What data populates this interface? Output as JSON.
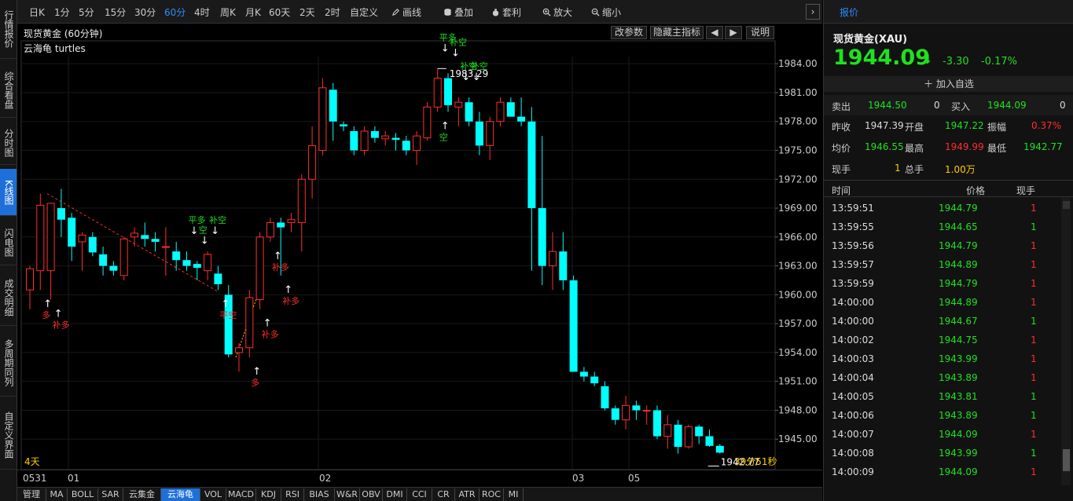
{
  "sidebar": {
    "tabs": [
      {
        "label": "行情报价",
        "active": false
      },
      {
        "label": "综合看盘",
        "active": false
      },
      {
        "label": "分时图",
        "active": false
      },
      {
        "label": "K线图",
        "active": true
      },
      {
        "label": "闪电图",
        "active": false
      },
      {
        "label": "成交明细",
        "active": false
      },
      {
        "label": "多周期同列",
        "active": false
      },
      {
        "label": "自定义界面",
        "active": false
      }
    ]
  },
  "toolbar": {
    "periods": [
      "日K",
      "1分",
      "5分",
      "15分",
      "30分",
      "60分",
      "4时",
      "周K",
      "月K",
      "60天",
      "2天",
      "2时",
      "自定义"
    ],
    "active_period": "60分",
    "tools": {
      "draw": "画线",
      "overlay": "叠加",
      "arbitrage": "套利",
      "zoom_in": "放大",
      "zoom_out": "缩小"
    },
    "next_icon": "chevron-right-icon"
  },
  "chart_header": {
    "title": "现货黄金 (60分钟)",
    "params_button": "改参数",
    "hide_indicator_button": "隐藏主指标",
    "explain_button": "说明",
    "indicator_label": "云海龟 turtles"
  },
  "chart_data": {
    "type": "candlestick",
    "title": "现货黄金 (60分钟)",
    "y_ticks": [
      "1984.00",
      "1981.00",
      "1978.00",
      "1975.00",
      "1972.00",
      "1969.00",
      "1966.00",
      "1963.00",
      "1960.00",
      "1957.00",
      "1954.00",
      "1951.00",
      "1948.00",
      "1945.00"
    ],
    "ylim": [
      1942.0,
      1985.4
    ],
    "x_labels": [
      "0531",
      "01",
      "02",
      "03",
      "05"
    ],
    "period_label": "4天",
    "countdown": "39分51秒",
    "high_label": "1983.29",
    "low_label": "1942.77",
    "candles": [
      {
        "o": 1960.5,
        "h": 1963.0,
        "l": 1958.5,
        "c": 1962.7
      },
      {
        "o": 1962.5,
        "h": 1970.5,
        "l": 1960.5,
        "c": 1969.3
      },
      {
        "o": 1962.5,
        "h": 1969.5,
        "l": 1959.5,
        "c": 1969.5
      },
      {
        "o": 1969.0,
        "h": 1971.0,
        "l": 1966.0,
        "c": 1967.8
      },
      {
        "o": 1968.0,
        "h": 1968.5,
        "l": 1963.5,
        "c": 1965.0
      },
      {
        "o": 1965.5,
        "h": 1966.5,
        "l": 1962.5,
        "c": 1966.2
      },
      {
        "o": 1966.0,
        "h": 1966.5,
        "l": 1964.0,
        "c": 1964.4
      },
      {
        "o": 1964.2,
        "h": 1965.0,
        "l": 1962.0,
        "c": 1963.0
      },
      {
        "o": 1963.0,
        "h": 1963.5,
        "l": 1962.0,
        "c": 1962.5
      },
      {
        "o": 1962.0,
        "h": 1966.0,
        "l": 1961.5,
        "c": 1965.8
      },
      {
        "o": 1966.0,
        "h": 1967.0,
        "l": 1965.0,
        "c": 1966.4
      },
      {
        "o": 1966.2,
        "h": 1967.5,
        "l": 1965.0,
        "c": 1965.8
      },
      {
        "o": 1965.8,
        "h": 1966.5,
        "l": 1964.5,
        "c": 1965.5
      },
      {
        "o": 1965.0,
        "h": 1967.0,
        "l": 1962.0,
        "c": 1965.0
      },
      {
        "o": 1964.5,
        "h": 1965.5,
        "l": 1962.5,
        "c": 1963.6
      },
      {
        "o": 1963.6,
        "h": 1964.5,
        "l": 1962.5,
        "c": 1963.0
      },
      {
        "o": 1963.2,
        "h": 1963.5,
        "l": 1961.5,
        "c": 1962.8
      },
      {
        "o": 1962.5,
        "h": 1964.5,
        "l": 1961.5,
        "c": 1964.2
      },
      {
        "o": 1962.2,
        "h": 1963.0,
        "l": 1960.5,
        "c": 1961.1
      },
      {
        "o": 1960.0,
        "h": 1961.0,
        "l": 1953.5,
        "c": 1953.8
      },
      {
        "o": 1954.0,
        "h": 1955.0,
        "l": 1952.0,
        "c": 1954.5
      },
      {
        "o": 1954.5,
        "h": 1960.5,
        "l": 1953.5,
        "c": 1959.7
      },
      {
        "o": 1959.5,
        "h": 1966.5,
        "l": 1958.5,
        "c": 1966.0
      },
      {
        "o": 1966.0,
        "h": 1968.0,
        "l": 1965.5,
        "c": 1967.5
      },
      {
        "o": 1967.5,
        "h": 1968.0,
        "l": 1962.0,
        "c": 1967.0
      },
      {
        "o": 1967.5,
        "h": 1968.5,
        "l": 1966.5,
        "c": 1967.8
      },
      {
        "o": 1967.5,
        "h": 1972.5,
        "l": 1964.5,
        "c": 1972.0
      },
      {
        "o": 1972.0,
        "h": 1977.5,
        "l": 1970.0,
        "c": 1975.5
      },
      {
        "o": 1975.0,
        "h": 1982.5,
        "l": 1974.5,
        "c": 1981.5
      },
      {
        "o": 1981.3,
        "h": 1982.0,
        "l": 1976.0,
        "c": 1978.0
      },
      {
        "o": 1977.7,
        "h": 1978.0,
        "l": 1977.0,
        "c": 1977.5
      },
      {
        "o": 1977.0,
        "h": 1977.5,
        "l": 1974.5,
        "c": 1975.0
      },
      {
        "o": 1975.0,
        "h": 1977.5,
        "l": 1974.5,
        "c": 1977.0
      },
      {
        "o": 1977.0,
        "h": 1977.5,
        "l": 1975.8,
        "c": 1976.3
      },
      {
        "o": 1976.2,
        "h": 1977.0,
        "l": 1975.5,
        "c": 1976.5
      },
      {
        "o": 1976.3,
        "h": 1976.8,
        "l": 1975.0,
        "c": 1976.1
      },
      {
        "o": 1976.0,
        "h": 1976.5,
        "l": 1974.5,
        "c": 1975.0
      },
      {
        "o": 1975.0,
        "h": 1977.0,
        "l": 1973.5,
        "c": 1976.5
      },
      {
        "o": 1976.3,
        "h": 1980.0,
        "l": 1976.0,
        "c": 1979.5
      },
      {
        "o": 1979.5,
        "h": 1983.5,
        "l": 1979.0,
        "c": 1982.5
      },
      {
        "o": 1982.5,
        "h": 1983.0,
        "l": 1979.0,
        "c": 1979.7
      },
      {
        "o": 1979.5,
        "h": 1980.5,
        "l": 1977.5,
        "c": 1980.0
      },
      {
        "o": 1980.0,
        "h": 1980.5,
        "l": 1977.5,
        "c": 1978.0
      },
      {
        "o": 1978.0,
        "h": 1979.0,
        "l": 1974.5,
        "c": 1975.5
      },
      {
        "o": 1975.5,
        "h": 1978.5,
        "l": 1974.0,
        "c": 1978.0
      },
      {
        "o": 1978.0,
        "h": 1980.5,
        "l": 1977.5,
        "c": 1980.0
      },
      {
        "o": 1980.0,
        "h": 1980.5,
        "l": 1978.5,
        "c": 1978.5
      },
      {
        "o": 1978.5,
        "h": 1980.5,
        "l": 1977.5,
        "c": 1978.0
      },
      {
        "o": 1978.0,
        "h": 1979.5,
        "l": 1962.5,
        "c": 1969.0
      },
      {
        "o": 1969.0,
        "h": 1976.5,
        "l": 1961.0,
        "c": 1963.0
      },
      {
        "o": 1963.0,
        "h": 1966.5,
        "l": 1960.5,
        "c": 1964.5
      },
      {
        "o": 1964.5,
        "h": 1966.5,
        "l": 1960.5,
        "c": 1961.5
      },
      {
        "o": 1961.5,
        "h": 1962.0,
        "l": 1952.0,
        "c": 1952.0
      },
      {
        "o": 1952.0,
        "h": 1952.5,
        "l": 1951.0,
        "c": 1951.5
      },
      {
        "o": 1951.5,
        "h": 1952.0,
        "l": 1950.5,
        "c": 1950.8
      },
      {
        "o": 1950.5,
        "h": 1951.0,
        "l": 1948.0,
        "c": 1948.2
      },
      {
        "o": 1948.2,
        "h": 1948.5,
        "l": 1946.5,
        "c": 1947.0
      },
      {
        "o": 1947.0,
        "h": 1949.5,
        "l": 1946.0,
        "c": 1948.5
      },
      {
        "o": 1948.5,
        "h": 1949.0,
        "l": 1947.0,
        "c": 1948.0
      },
      {
        "o": 1948.0,
        "h": 1948.5,
        "l": 1946.5,
        "c": 1948.0
      },
      {
        "o": 1948.0,
        "h": 1948.5,
        "l": 1945.0,
        "c": 1945.3
      },
      {
        "o": 1945.3,
        "h": 1947.5,
        "l": 1944.0,
        "c": 1946.5
      },
      {
        "o": 1946.5,
        "h": 1947.0,
        "l": 1943.5,
        "c": 1944.2
      },
      {
        "o": 1944.2,
        "h": 1946.5,
        "l": 1944.0,
        "c": 1946.3
      },
      {
        "o": 1946.3,
        "h": 1946.5,
        "l": 1944.5,
        "c": 1945.3
      },
      {
        "o": 1945.3,
        "h": 1946.0,
        "l": 1944.2,
        "c": 1944.3
      },
      {
        "o": 1944.3,
        "h": 1944.5,
        "l": 1943.5,
        "c": 1943.6
      }
    ],
    "signals": [
      {
        "label": "多",
        "color": "#ff2d2d",
        "arrow": "up",
        "index": 1
      },
      {
        "label": "补多",
        "color": "#ff2d2d",
        "arrow": "up",
        "index": 2
      },
      {
        "label": "平多",
        "color": "#1fe11f",
        "arrow": "down",
        "index": 15
      },
      {
        "label": "空",
        "color": "#1fe11f",
        "arrow": "down",
        "index": 16
      },
      {
        "label": "补空",
        "color": "#1fe11f",
        "arrow": "down",
        "index": 17
      },
      {
        "label": "平空",
        "color": "#ff2d2d",
        "arrow": "up",
        "index": 18
      },
      {
        "label": "多",
        "color": "#ff2d2d",
        "arrow": "up",
        "index": 21
      },
      {
        "label": "补多",
        "color": "#ff2d2d",
        "arrow": "up",
        "index": 22
      },
      {
        "label": "补多",
        "color": "#ff2d2d",
        "arrow": "up",
        "index": 23
      },
      {
        "label": "补多",
        "color": "#ff2d2d",
        "arrow": "up",
        "index": 24
      },
      {
        "label": "平多",
        "color": "#1fe11f",
        "arrow": "down",
        "index": 39
      },
      {
        "label": "补空",
        "color": "#1fe11f",
        "arrow": "down",
        "index": 40
      },
      {
        "label": "空",
        "color": "#1fe11f",
        "arrow": "up",
        "index": 39
      },
      {
        "label": "补空",
        "color": "#1fe11f",
        "arrow": "down",
        "index": 41
      },
      {
        "label": "补空",
        "color": "#1fe11f",
        "arrow": "down",
        "index": 42
      }
    ],
    "colors": {
      "up": "#ff2d2d",
      "down": "#00ffff",
      "trend": "#ff2d2d"
    }
  },
  "bottom_tabs": {
    "items": [
      "管理",
      "MA",
      "BOLL",
      "SAR",
      "云集金",
      "云海龟",
      "VOL",
      "MACD",
      "KDJ",
      "RSI",
      "BIAS",
      "W&R",
      "OBV",
      "DMI",
      "CCI",
      "CR",
      "ATR",
      "ROC",
      "MI"
    ],
    "active": "云海龟"
  },
  "quote": {
    "tab": "报价",
    "name": "现货黄金(XAU)",
    "price": "1944.09",
    "change": "-3.30",
    "change_pct": "-0.17%",
    "add_watch": "加入自选",
    "sell_label": "卖出",
    "sell_price": "1944.50",
    "sell_vol": "0",
    "buy_label": "买入",
    "buy_price": "1944.09",
    "buy_vol": "0",
    "prev_close_label": "昨收",
    "prev_close": "1947.39",
    "open_label": "开盘",
    "open": "1947.22",
    "amplitude_label": "振幅",
    "amplitude": "0.37%",
    "avg_label": "均价",
    "avg": "1946.55",
    "high_label": "最高",
    "high": "1949.99",
    "low_label": "最低",
    "low": "1942.77",
    "current_vol_label": "现手",
    "current_vol": "1",
    "total_vol_label": "总手",
    "total_vol": "1.00万"
  },
  "ticks": {
    "headers": {
      "time": "时间",
      "price": "价格",
      "vol": "现手"
    },
    "rows": [
      {
        "time": "13:59:51",
        "price": "1944.79",
        "vol": "1",
        "dir": "up"
      },
      {
        "time": "13:59:55",
        "price": "1944.65",
        "vol": "1",
        "dir": "down"
      },
      {
        "time": "13:59:56",
        "price": "1944.79",
        "vol": "1",
        "dir": "up"
      },
      {
        "time": "13:59:57",
        "price": "1944.89",
        "vol": "1",
        "dir": "up"
      },
      {
        "time": "13:59:59",
        "price": "1944.79",
        "vol": "1",
        "dir": "up"
      },
      {
        "time": "14:00:00",
        "price": "1944.89",
        "vol": "1",
        "dir": "up"
      },
      {
        "time": "14:00:00",
        "price": "1944.67",
        "vol": "1",
        "dir": "down"
      },
      {
        "time": "14:00:02",
        "price": "1944.75",
        "vol": "1",
        "dir": "up"
      },
      {
        "time": "14:00:03",
        "price": "1943.99",
        "vol": "1",
        "dir": "up"
      },
      {
        "time": "14:00:04",
        "price": "1943.89",
        "vol": "1",
        "dir": "up"
      },
      {
        "time": "14:00:05",
        "price": "1943.81",
        "vol": "1",
        "dir": "down"
      },
      {
        "time": "14:00:06",
        "price": "1943.89",
        "vol": "1",
        "dir": "down"
      },
      {
        "time": "14:00:07",
        "price": "1944.09",
        "vol": "1",
        "dir": "up"
      },
      {
        "time": "14:00:08",
        "price": "1943.99",
        "vol": "1",
        "dir": "down"
      },
      {
        "time": "14:00:09",
        "price": "1944.09",
        "vol": "1",
        "dir": "up"
      }
    ]
  }
}
